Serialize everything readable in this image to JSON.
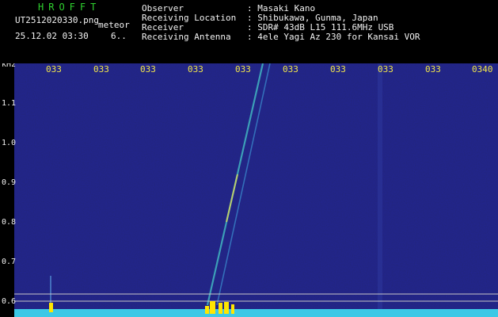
{
  "header": {
    "app_title": "HROFFT",
    "file_name": "UT2512020330.png",
    "file_tag": "meteor",
    "date_time": "25.12.02 03:30",
    "count": "6..",
    "fields": [
      {
        "label": "Observer",
        "value": ": Masaki Kano"
      },
      {
        "label": "Receiving Location",
        "value": ": Shibukawa, Gunma, Japan"
      },
      {
        "label": "Receiver",
        "value": ": SDR# 43dB L15 111.6MHz USB"
      },
      {
        "label": "Receiving Antenna",
        "value": ": 4ele Yagi Az 230 for Kansai VOR"
      }
    ]
  },
  "spectrogram": {
    "freq_unit": "kHz",
    "freq_ticks": [
      "1.1",
      "1.0",
      "0.9",
      "0.8",
      "0.7",
      "0.6"
    ],
    "time_ticks": [
      "033",
      "033",
      "033",
      "033",
      "033",
      "033",
      "033",
      "033",
      "033",
      "0340"
    ],
    "colors": {
      "background": "#13126b",
      "guide_line": "#c8c8c8",
      "baseline": "#3cc8e6",
      "burst": "#ffe600",
      "trail": "#46c8c8",
      "text": "#f2f2f2",
      "time_text": "#f2e64a"
    }
  }
}
